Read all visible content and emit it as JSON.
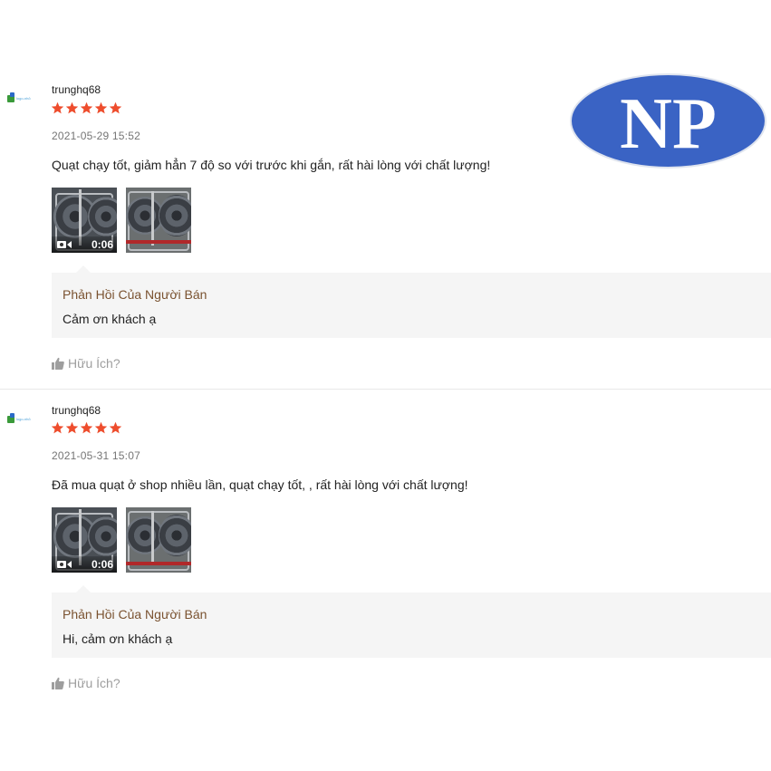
{
  "colors": {
    "star": "#ee4d2d",
    "seller_reply_title": "#7a5230",
    "reply_background": "#f5f5f5",
    "muted": "#757575",
    "np_logo_blue": "#3a63c4"
  },
  "watermark": {
    "text": "NP",
    "icon": "np-logo-ellipse"
  },
  "reviews": [
    {
      "avatar_text": "logo-nhỏ",
      "username": "trunghq68",
      "rating": 5,
      "date": "2021-05-29 15:52",
      "comment": "Quạt chạy tốt, giảm hẳn 7 độ so với trước khi gắn, rất hài lòng với chất lượng!",
      "media": [
        {
          "type": "video",
          "duration": "0:06",
          "icon": "video-camera-icon"
        },
        {
          "type": "image"
        }
      ],
      "seller_reply": {
        "title": "Phản Hồi Của Người Bán",
        "text": "Cảm ơn khách ạ"
      },
      "helpful_label": "Hữu Ích?"
    },
    {
      "avatar_text": "logo-nhỏ",
      "username": "trunghq68",
      "rating": 5,
      "date": "2021-05-31 15:07",
      "comment": "Đã mua quạt ở shop nhiều lần, quạt chạy tốt,  , rất hài lòng với chất lượng!",
      "media": [
        {
          "type": "video",
          "duration": "0:06",
          "icon": "video-camera-icon"
        },
        {
          "type": "image"
        }
      ],
      "seller_reply": {
        "title": "Phản Hồi Của Người Bán",
        "text": "Hi, cảm ơn khách ạ"
      },
      "helpful_label": "Hữu Ích?"
    }
  ]
}
